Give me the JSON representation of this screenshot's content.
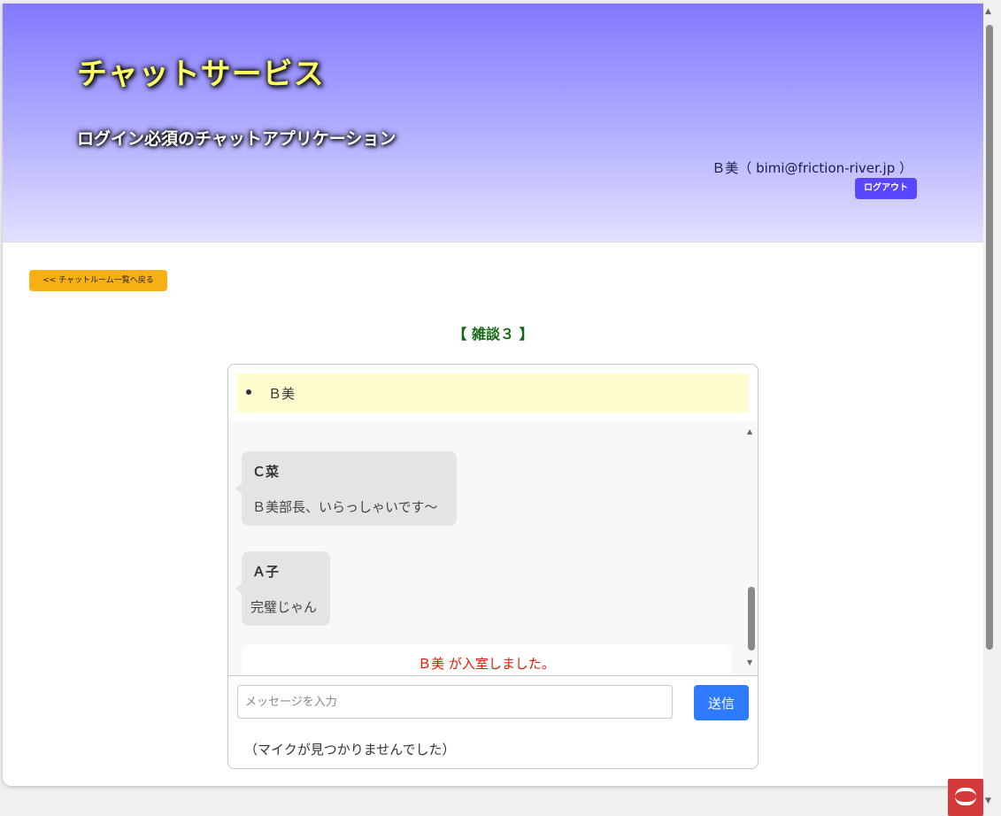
{
  "header": {
    "title": "チャットサービス",
    "subtitle": "ログイン必須のチャットアプリケーション",
    "user_info": "Ｂ美（ bimi@friction-river.jp ）",
    "logout_label": "ログアウト"
  },
  "back_label": "<< チャットルーム一覧へ戻る",
  "room_title": "【 雑談３ 】",
  "members": [
    "Ｂ美"
  ],
  "messages": [
    {
      "name": "Ｃ菜",
      "text": "Ｂ美部長、いらっしゃいです〜"
    },
    {
      "name": "Ａ子",
      "text": "完璧じゃん"
    }
  ],
  "system_message": "Ｂ美 が入室しました。",
  "input": {
    "placeholder": "メッセージを入力",
    "value": "",
    "send_label": "送信"
  },
  "mic_status": "（マイクが見つかりませんでした）",
  "colors": {
    "header_top": "#8478ff",
    "logout_button": "#5a46ff",
    "back_button": "#f6b014",
    "room_title": "#146a14",
    "send_button": "#2f7bff",
    "system_message": "#e01a00",
    "member_highlight": "#fffcd0"
  },
  "icons": {
    "scroll_up": "triangle-up-icon",
    "scroll_down": "triangle-down-icon",
    "corner_logo": "extension-logo-icon"
  }
}
